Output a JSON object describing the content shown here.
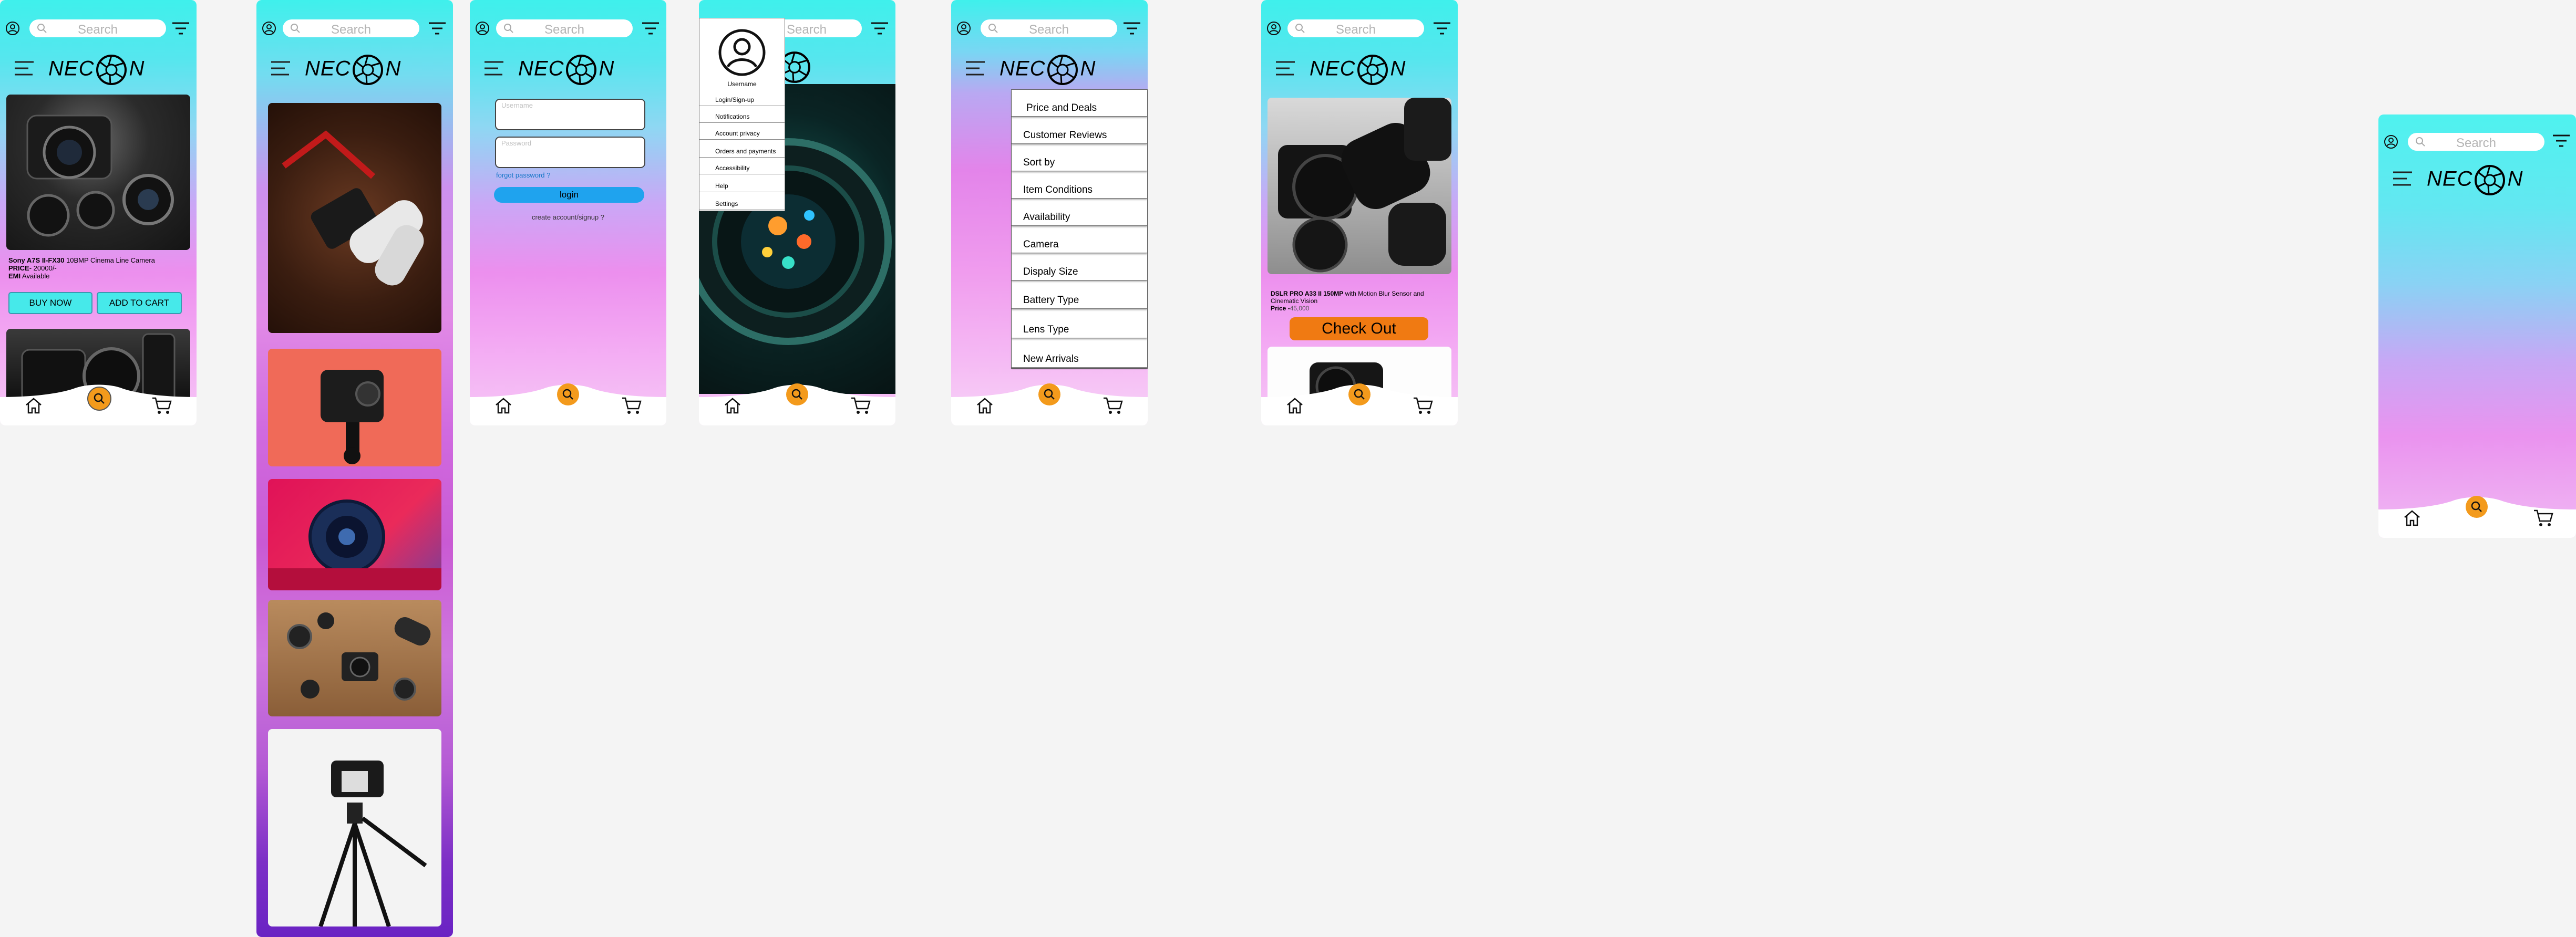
{
  "common": {
    "search_placeholder": "Search",
    "brand_prefix": "NEC",
    "brand_suffix": "N"
  },
  "colors": {
    "accent_cyan": "#3ff0ec",
    "pink": "#ec8fee",
    "orange": "#f39a1c",
    "login_blue": "#1fa3ee",
    "checkout_orange": "#f07a12"
  },
  "icons": [
    "profile-icon",
    "search-icon",
    "filter-icon",
    "hamburger-icon",
    "aperture-logo-icon",
    "home-icon",
    "cart-icon"
  ],
  "screen1": {
    "product_name": "Sony A7S II-FX30",
    "product_desc": " 10BMP Cinema Line Camera",
    "price_label": "PRICE",
    "price_value": "- 20000/-",
    "emi_label": "EMI",
    "emi_value": " Available",
    "buy_now": "BUY NOW",
    "add_to_cart": "ADD TO CART"
  },
  "screen3": {
    "username_placeholder": "Username",
    "password_placeholder": "Password",
    "forgot_password": "forgot password ?",
    "login": "login",
    "create_account": "create account/signup ?"
  },
  "screen4": {
    "username": "Username",
    "menu": [
      "Login/Sign-up",
      "Notifications",
      "Account privacy",
      "Orders and payments",
      "Accessibility",
      "Help",
      "Settings"
    ]
  },
  "screen5": {
    "filters": [
      "Price and Deals",
      "Customer Reviews",
      "Sort by",
      "Item Conditions",
      "Availability",
      "Camera",
      "Dispaly Size",
      "Battery Type",
      "Lens Type",
      "New Arrivals"
    ]
  },
  "screen6": {
    "product_name": "DSLR PRO A33 II 150MP",
    "product_desc": " with Motion Blur Sensor and Cinematic Vision",
    "price_label": "Price -",
    "price_value": "45,000",
    "checkout": "Check Out"
  }
}
